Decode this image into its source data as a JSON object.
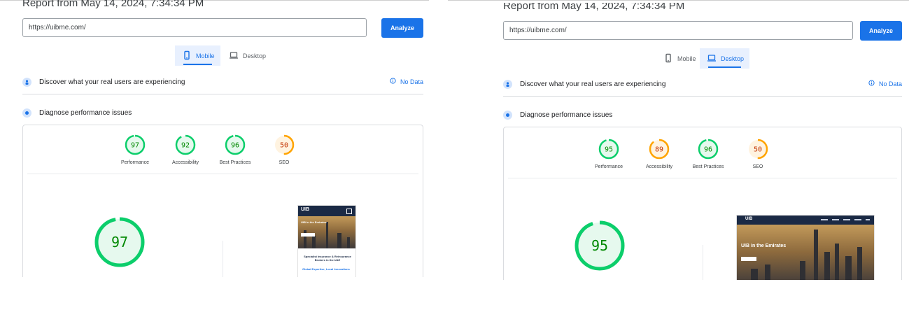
{
  "colors": {
    "pass": "#0cce6b",
    "average": "#ffa400",
    "pass_text": "#008800",
    "average_text": "#c33300",
    "accent": "#1a73e8"
  },
  "panels": [
    {
      "report_title": "Report from May 14, 2024, 7:34:34 PM",
      "url": "https://uibme.com/",
      "analyze_label": "Analyze",
      "tabs": [
        {
          "label": "Mobile",
          "icon": "phone-icon",
          "active": true
        },
        {
          "label": "Desktop",
          "icon": "laptop-icon",
          "active": false
        }
      ],
      "field_data": {
        "label": "Discover what your real users are experiencing",
        "no_data": "No Data"
      },
      "diagnose_label": "Diagnose performance issues",
      "scores": [
        {
          "label": "Performance",
          "value": "97",
          "status": "pass"
        },
        {
          "label": "Accessibility",
          "value": "92",
          "status": "pass"
        },
        {
          "label": "Best Practices",
          "value": "96",
          "status": "pass"
        },
        {
          "label": "SEO",
          "value": "50",
          "status": "average"
        }
      ],
      "big_score": "97",
      "screenshot": {
        "brand": "UIB",
        "hero_title": "UIB in the Emirates",
        "body_title": "Specialist Insurance & Reinsurance Brokers in the UAE",
        "body_link": "Global Expertise, Local Innovations"
      }
    },
    {
      "report_title": "Report from May 14, 2024, 7:34:34 PM",
      "url": "https://uibme.com/",
      "analyze_label": "Analyze",
      "tabs": [
        {
          "label": "Mobile",
          "icon": "phone-icon",
          "active": false
        },
        {
          "label": "Desktop",
          "icon": "laptop-icon",
          "active": true
        }
      ],
      "field_data": {
        "label": "Discover what your real users are experiencing",
        "no_data": "No Data"
      },
      "diagnose_label": "Diagnose performance issues",
      "scores": [
        {
          "label": "Performance",
          "value": "95",
          "status": "pass"
        },
        {
          "label": "Accessibility",
          "value": "89",
          "status": "average"
        },
        {
          "label": "Best Practices",
          "value": "96",
          "status": "pass"
        },
        {
          "label": "SEO",
          "value": "50",
          "status": "average"
        }
      ],
      "big_score": "95",
      "screenshot": {
        "brand": "UIB",
        "hero_title": "UIB in the Emirates"
      }
    }
  ]
}
